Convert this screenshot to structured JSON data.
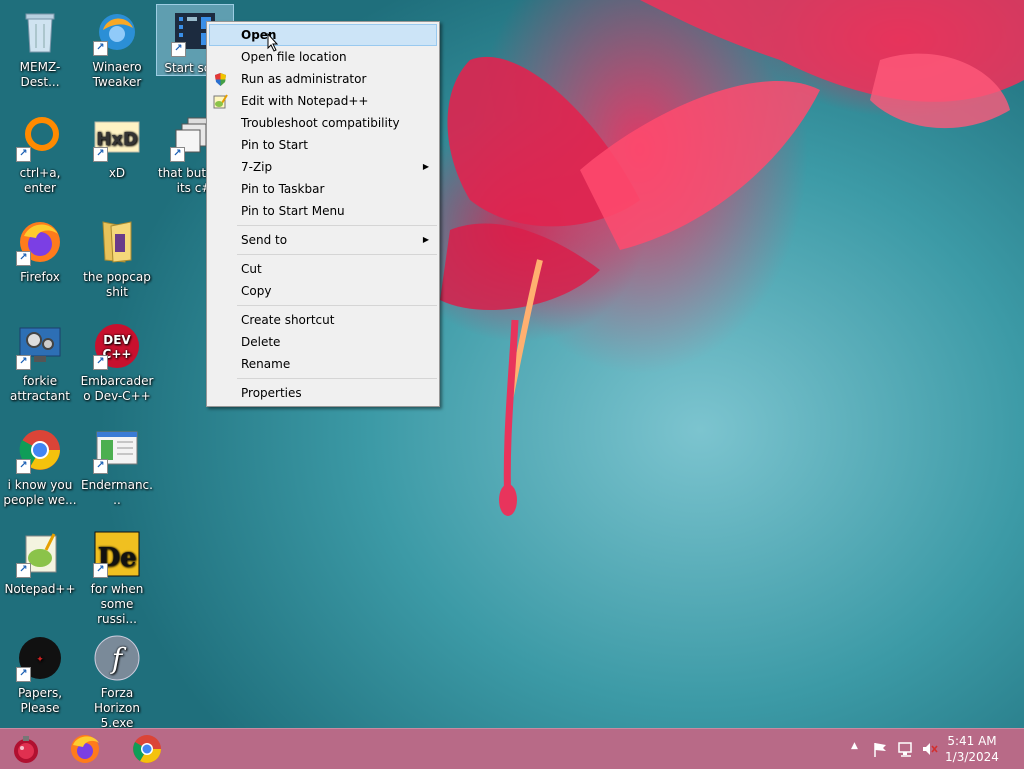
{
  "desktop_icons": [
    {
      "label": "MEMZ-Dest...",
      "icon": "recycle-bin-icon"
    },
    {
      "label": "Winaero Tweaker",
      "icon": "winaero-icon"
    },
    {
      "label": "Start scr...",
      "icon": "start-screen-icon"
    },
    {
      "label": "ctrl+a, enter",
      "icon": "orange-ring-icon"
    },
    {
      "label": "xD",
      "icon": "hxd-icon"
    },
    {
      "label": "that but w... its c#",
      "icon": "windows-stack-icon"
    },
    {
      "label": "Firefox",
      "icon": "firefox-icon"
    },
    {
      "label": "the popcap shit",
      "icon": "folder-icon"
    },
    {
      "label": "forkie attractant",
      "icon": "settings-monitor-icon"
    },
    {
      "label": "Embarcadero Dev-C++",
      "icon": "devcpp-icon"
    },
    {
      "label": "i know you people we...",
      "icon": "chrome-icon"
    },
    {
      "label": "Endermanc...",
      "icon": "window-app-icon"
    },
    {
      "label": "Notepad++",
      "icon": "notepadpp-icon"
    },
    {
      "label": "for when some russi...",
      "icon": "de-icon"
    },
    {
      "label": "Papers, Please",
      "icon": "papers-please-icon"
    },
    {
      "label": "Forza Horizon 5.exe",
      "icon": "flash-icon"
    }
  ],
  "context_menu": {
    "items": {
      "open": "Open",
      "open_file_location": "Open file location",
      "run_as_admin": "Run as administrator",
      "edit_notepadpp": "Edit with Notepad++",
      "troubleshoot": "Troubleshoot compatibility",
      "pin_start": "Pin to Start",
      "seven_zip": "7-Zip",
      "pin_taskbar": "Pin to Taskbar",
      "pin_start_menu": "Pin to Start Menu",
      "send_to": "Send to",
      "cut": "Cut",
      "copy": "Copy",
      "create_shortcut": "Create shortcut",
      "delete": "Delete",
      "rename": "Rename",
      "properties": "Properties"
    },
    "submenu_glyph": "▶"
  },
  "taskbar": {
    "apps": [
      "start-orb-icon",
      "firefox-icon",
      "chrome-icon"
    ],
    "tray": {
      "chevron": "▲"
    },
    "clock": {
      "time": "5:41 AM",
      "date": "1/3/2024"
    }
  },
  "colors": {
    "taskbar": "#b86a87",
    "menu_highlight": "#cce4f7",
    "desktop_bg": "#3c9aa6"
  }
}
